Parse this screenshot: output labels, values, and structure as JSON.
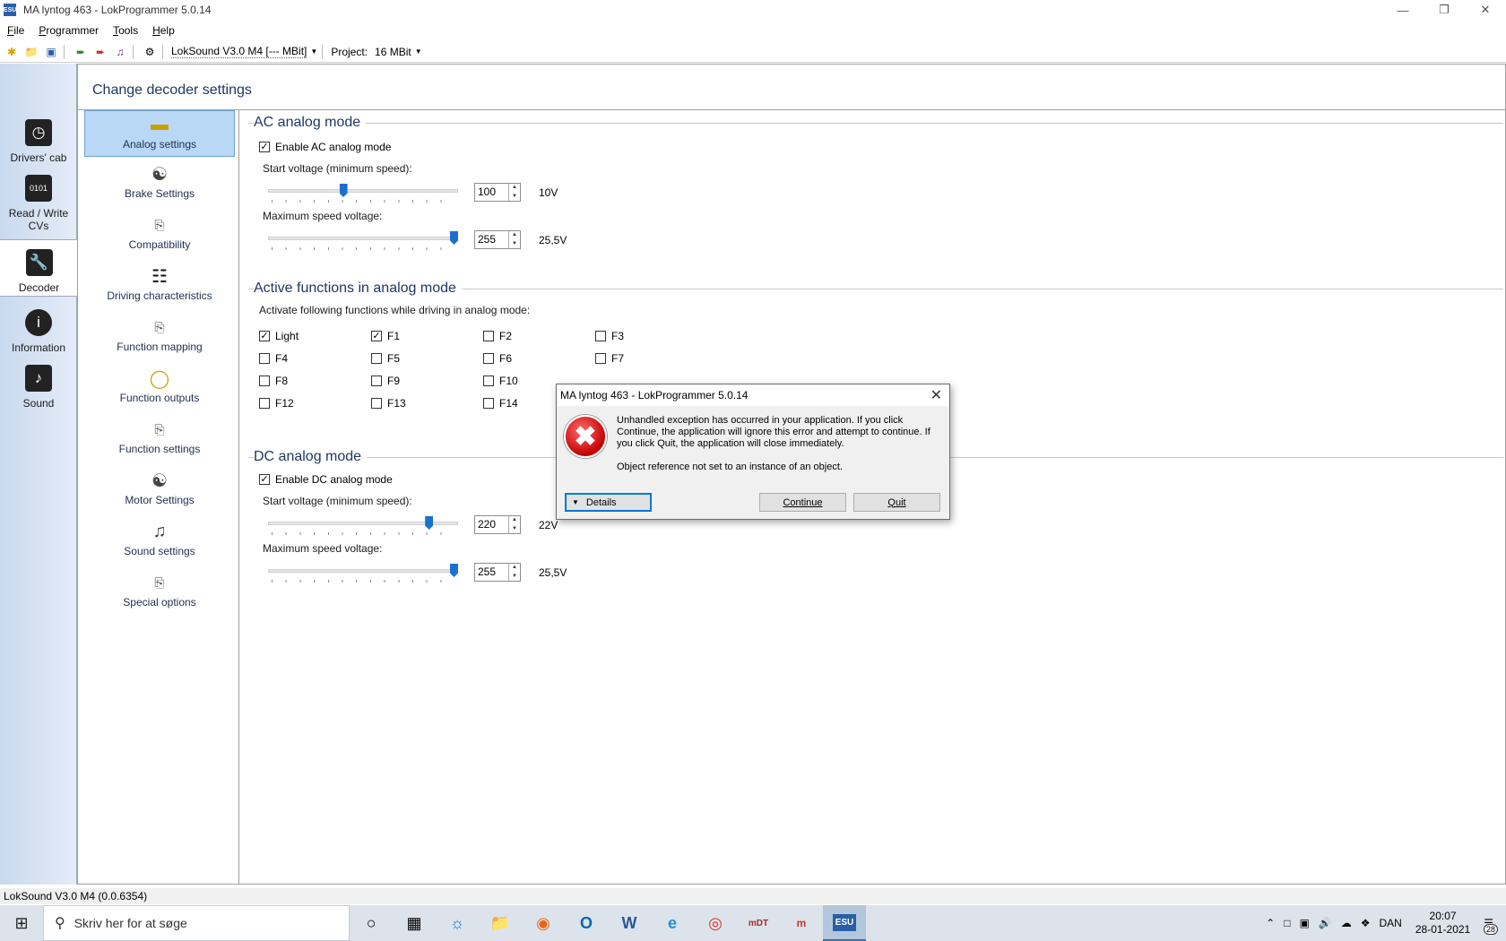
{
  "window": {
    "title": "MA lyntog 463 - LokProgrammer 5.0.14",
    "app_icon_text": "ESU"
  },
  "menu": [
    "File",
    "Programmer",
    "Tools",
    "Help"
  ],
  "toolbar": {
    "decoder_select": "LokSound V3.0 M4 [--- MBit]",
    "project_label": "Project:",
    "project_select": "16 MBit"
  },
  "leftnav": [
    {
      "label": "Drivers' cab",
      "icon": "clock-icon"
    },
    {
      "label": "Read / Write CVs",
      "icon": "binary-icon"
    },
    {
      "label": "Decoder",
      "icon": "wrench-icon"
    },
    {
      "label": "Information",
      "icon": "info-icon"
    },
    {
      "label": "Sound",
      "icon": "note-icon"
    }
  ],
  "main": {
    "title": "Change decoder settings",
    "settings_list": [
      "Analog settings",
      "Brake Settings",
      "Compatibility",
      "Driving characteristics",
      "Function mapping",
      "Function outputs",
      "Function settings",
      "Motor Settings",
      "Sound settings",
      "Special options"
    ],
    "ac": {
      "section_title": "AC analog mode",
      "enable_label": "Enable AC analog mode",
      "enabled": true,
      "start_label": "Start voltage (minimum speed):",
      "start_value": "100",
      "start_unit": "10V",
      "start_fraction": 0.392,
      "max_label": "Maximum speed voltage:",
      "max_value": "255",
      "max_unit": "25,5V",
      "max_fraction": 1.0
    },
    "functions": {
      "section_title": "Active functions in analog mode",
      "desc": "Activate following functions while driving in analog mode:",
      "items": [
        {
          "label": "Light",
          "checked": true
        },
        {
          "label": "F1",
          "checked": true
        },
        {
          "label": "F2",
          "checked": false
        },
        {
          "label": "F3",
          "checked": false
        },
        {
          "label": "F4",
          "checked": false
        },
        {
          "label": "F5",
          "checked": false
        },
        {
          "label": "F6",
          "checked": false
        },
        {
          "label": "F7",
          "checked": false
        },
        {
          "label": "F8",
          "checked": false
        },
        {
          "label": "F9",
          "checked": false
        },
        {
          "label": "F10",
          "checked": false
        },
        {
          "label": "F12",
          "checked": false
        },
        {
          "label": "F13",
          "checked": false
        },
        {
          "label": "F14",
          "checked": false
        }
      ]
    },
    "dc": {
      "section_title": "DC analog mode",
      "enable_label": "Enable DC analog mode",
      "enabled": true,
      "start_label": "Start voltage (minimum speed):",
      "start_value": "220",
      "start_unit": "22V",
      "start_fraction": 0.863,
      "max_label": "Maximum speed voltage:",
      "max_value": "255",
      "max_unit": "25,5V",
      "max_fraction": 1.0
    }
  },
  "statusbar": "LokSound V3.0 M4 (0.0.6354)",
  "dialog": {
    "title": "MA lyntog 463 - LokProgrammer 5.0.14",
    "message": "Unhandled exception has occurred in your application. If you click Continue, the application will ignore this error and attempt to continue. If you click Quit, the application will close immediately.",
    "detail": "Object reference not set to an instance of an object.",
    "details_button": "Details",
    "continue_button": "Continue",
    "quit_button": "Quit"
  },
  "taskbar": {
    "search_placeholder": "Skriv her for at søge",
    "apps": [
      "cortana-icon",
      "taskview-icon",
      "edge-icon",
      "explorer-icon",
      "firefox-icon",
      "outlook-icon",
      "word-icon",
      "ie-icon",
      "chrome-icon",
      "mdt-icon",
      "ms-icon",
      "esu-icon"
    ],
    "language": "DAN",
    "time": "20:07",
    "date": "28-01-2021",
    "notification_count": "28"
  }
}
